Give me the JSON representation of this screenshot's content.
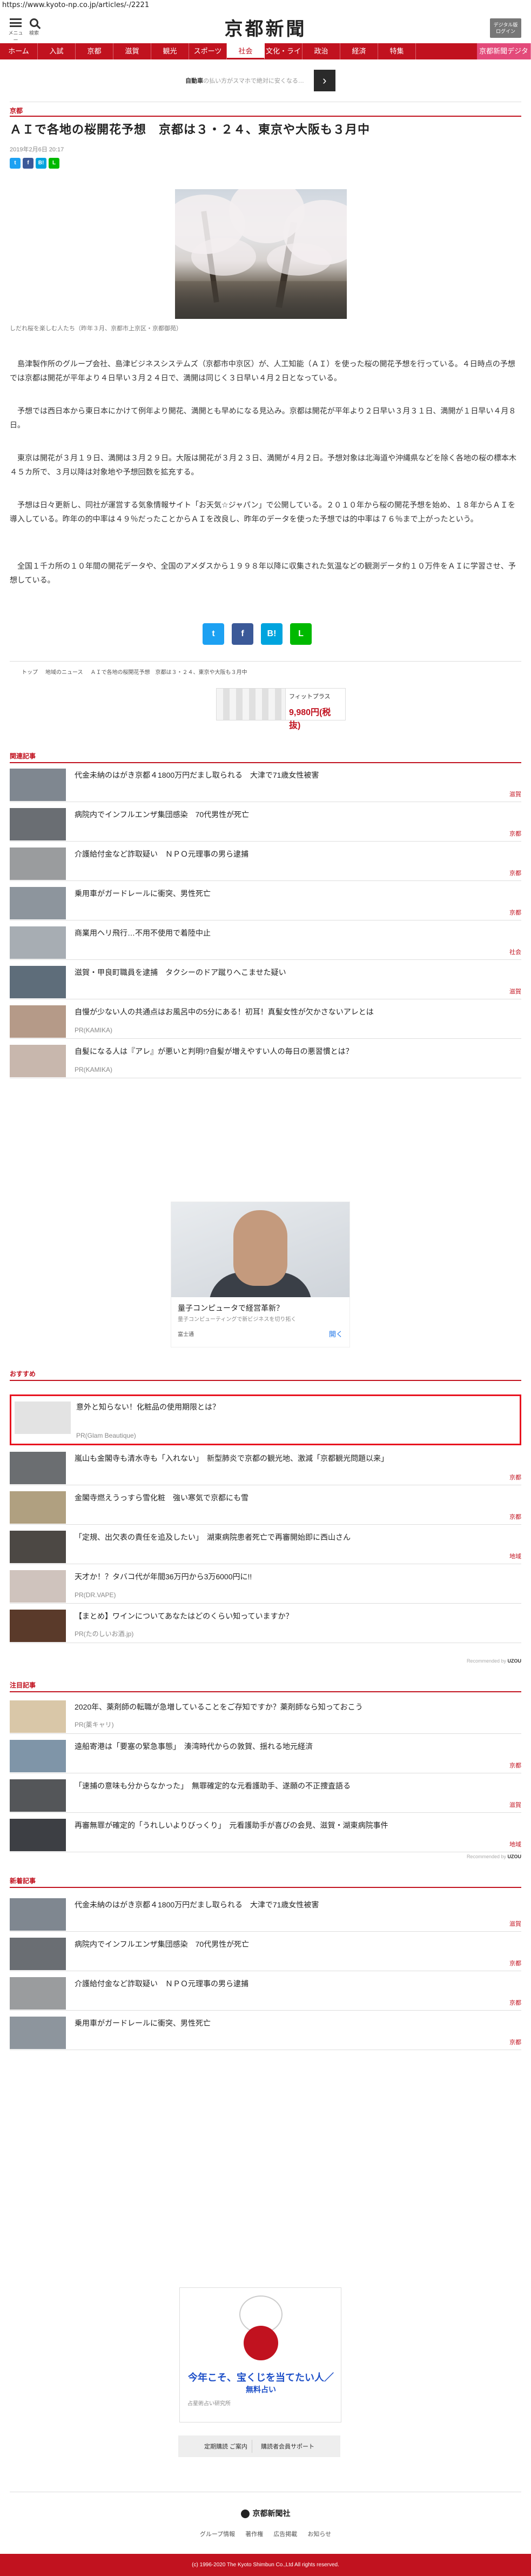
{
  "url": "https://www.kyoto-np.co.jp/articles/-/2221",
  "header": {
    "menu_label": "メニュー",
    "search_label": "検索",
    "logo": "京都新聞",
    "digital_btn_line1": "デジタル版",
    "digital_btn_line2": "ログイン"
  },
  "nav": {
    "items": [
      "ホーム",
      "入試",
      "京都",
      "滋賀",
      "観光",
      "スポーツ",
      "社会",
      "文化・ライフ",
      "政治",
      "経済",
      "特集",
      "京都新聞デジタル"
    ]
  },
  "ad_strip": {
    "text_prefix": "自動車",
    "text": "の払い方がスマホで絶対に安くなる…",
    "arrow": "›"
  },
  "article": {
    "section": "京都",
    "headline": "ＡＩで各地の桜開花予想　京都は３・２４、東京や大阪も３月中",
    "date": "2019年2月6日 20:17",
    "photo_caption": "しだれ桜を楽しむ人たち（昨年３月、京都市上京区・京都御苑）",
    "paragraphs": [
      "　島津製作所のグループ会社、島津ビジネスシステムズ（京都市中京区）が、人工知能（ＡＩ）を使った桜の開花予想を行っている。４日時点の予想では京都は開花が平年より４日早い３月２４日で、満開は同じく３日早い４月２日となっている。",
      "　予想では西日本から東日本にかけて例年より開花、満開とも早めになる見込み。京都は開花が平年より２日早い３月３１日、満開が１日早い４月８日。",
      "　東京は開花が３月１９日、満開は３月２９日。大阪は開花が３月２３日、満開が４月２日。予想対象は北海道や沖縄県などを除く各地の桜の標本木４５カ所で、３月以降は対象地や予想回数を拡充する。",
      "　予想は日々更新し、同社が運営する気象情報サイト「お天気☆ジャパン」で公開している。２０１０年から桜の開花予想を始め、１８年からＡＩを導入している。昨年の的中率は４９％だったことからＡＩを改良し、昨年のデータを使った予想では的中率は７６％まで上がったという。",
      "　全国１千カ所の１０年間の開花データや、全国のアメダスから１９９８年以降に収集された気温などの観測データ約１０万件をＡＩに学習させ、予想している。"
    ]
  },
  "share": {
    "twitter": "t",
    "facebook": "f",
    "hatena": "B!",
    "line": "L"
  },
  "breadcrumb": [
    "トップ",
    "地域のニュース",
    "ＡＩで各地の桜開花予想　京都は３・２４、東京や大阪も３月中"
  ],
  "top_ad": {
    "brand": "フィットプラス",
    "price": "9,980円(税抜)"
  },
  "related": {
    "heading": "関連記事",
    "items": [
      {
        "title": "代金未納のはがき京都４1800万円だまし取られる　大津で71歳女性被害",
        "tag": "滋賀"
      },
      {
        "title": "病院内でインフルエンザ集団感染　70代男性が死亡",
        "tag": "京都"
      },
      {
        "title": "介護給付金など詐取疑い　ＮＰＯ元理事の男ら逮捕",
        "tag": "京都"
      },
      {
        "title": "乗用車がガードレールに衝突、男性死亡",
        "tag": "京都"
      },
      {
        "title": "商業用ヘリ飛行…不用不使用で着陸中止",
        "tag": "社会"
      },
      {
        "title": "滋賀・甲良町職員を逮捕　タクシーのドア蹴りへこませた疑い",
        "tag": "滋賀"
      },
      {
        "title": "自慢が少ない人の共通点はお風呂中の5分にある！初耳！真髪女性が欠かさないアレとは",
        "tag": "",
        "pr": "PR(KAMIKA)"
      },
      {
        "title": "自髪になる人は『アレ』が悪いと判明!?自髪が増えやすい人の毎日の悪習慣とは？",
        "tag": "",
        "pr": "PR(KAMIKA)"
      }
    ]
  },
  "mid_ad": {
    "title": "量子コンピュータで経営革新？",
    "subtitle": "量子コンピューティングで新ビジネスを切り拓く",
    "source": "富士通",
    "cta": "開く"
  },
  "recommend": {
    "heading": "おすすめ",
    "items": [
      {
        "title": "意外と知らない！化粧品の使用期限とは？",
        "tag": "",
        "pr": "PR(Glam Beautique)",
        "highlight": true
      },
      {
        "title": "嵐山も金閣寺も清水寺も「入れない」　新型肺炎で京都の観光地、激減「京都観光問題以来」",
        "tag": "京都"
      },
      {
        "title": "金閣寺燃えうっすら雪化粧　強い寒気で京都にも雪",
        "tag": "京都"
      },
      {
        "title": "「定規、出欠表の責任を追及したい」　湖東病院患者死亡で再審開始即に西山さん",
        "tag": "地域"
      },
      {
        "title": "天才か！？タバコ代が年間36万円から3万6000円に!!",
        "tag": "",
        "pr": "PR(DR.VAPE)"
      },
      {
        "title": "【まとめ】ワインについてあなたはどのくらい知っていますか？",
        "tag": "",
        "pr": "PR(たのしいお酒.jp)"
      }
    ],
    "recommended_by": "Recommended by",
    "brand": "UZOU"
  },
  "featured": {
    "heading": "注目記事",
    "items": [
      {
        "title": "2020年、薬剤師の転職が急増していることをご存知ですか？薬剤師なら知っておこう",
        "tag": "",
        "pr": "PR(薬キャリ)"
      },
      {
        "title": "遠船寄港は「要塞の緊急事態」　湊湾時代からの敦賀、揺れる地元経済",
        "tag": "京都"
      },
      {
        "title": "「速捕の意味も分からなかった」　無罪確定的な元看護助手、遂願の不正捜査語る",
        "tag": "滋賀"
      },
      {
        "title": "再審無罪が確定的「うれしいよりびっくり」　元看護助手が喜びの会見、滋賀・湖東病院事件",
        "tag": "地域"
      }
    ],
    "recommended_by": "Recommended by",
    "brand": "UZOU"
  },
  "latest": {
    "heading": "新着記事",
    "items": [
      {
        "title": "代金未納のはがき京都４1800万円だまし取られる　大津で71歳女性被害",
        "tag": "滋賀"
      },
      {
        "title": "病院内でインフルエンザ集団感染　70代男性が死亡",
        "tag": "京都"
      },
      {
        "title": "介護給付金など詐取疑い　ＮＰＯ元理事の男ら逮捕",
        "tag": "京都"
      },
      {
        "title": "乗用車がガードレールに衝突、男性死亡",
        "tag": "京都"
      }
    ]
  },
  "bottom_ad": {
    "line1": "今年こそ、宝くじを当てたい人／",
    "line2": "無料占い",
    "source": "占星術占い研究所"
  },
  "subscribe": [
    "定期購読 ご案内",
    "購読者会員サポート"
  ],
  "footer": {
    "logo": "京都新聞社",
    "links": [
      "グループ情報",
      "著作権",
      "広告掲載",
      "お知らせ"
    ],
    "copyright": "(c) 1996-2020 The Kyoto Shimbun Co.,Ltd All rights reserved."
  },
  "colors": {
    "brand": "#c1121f",
    "twitter": "#1da1f2",
    "facebook": "#3b5998",
    "hatena": "#00a4de",
    "line": "#00b900"
  }
}
